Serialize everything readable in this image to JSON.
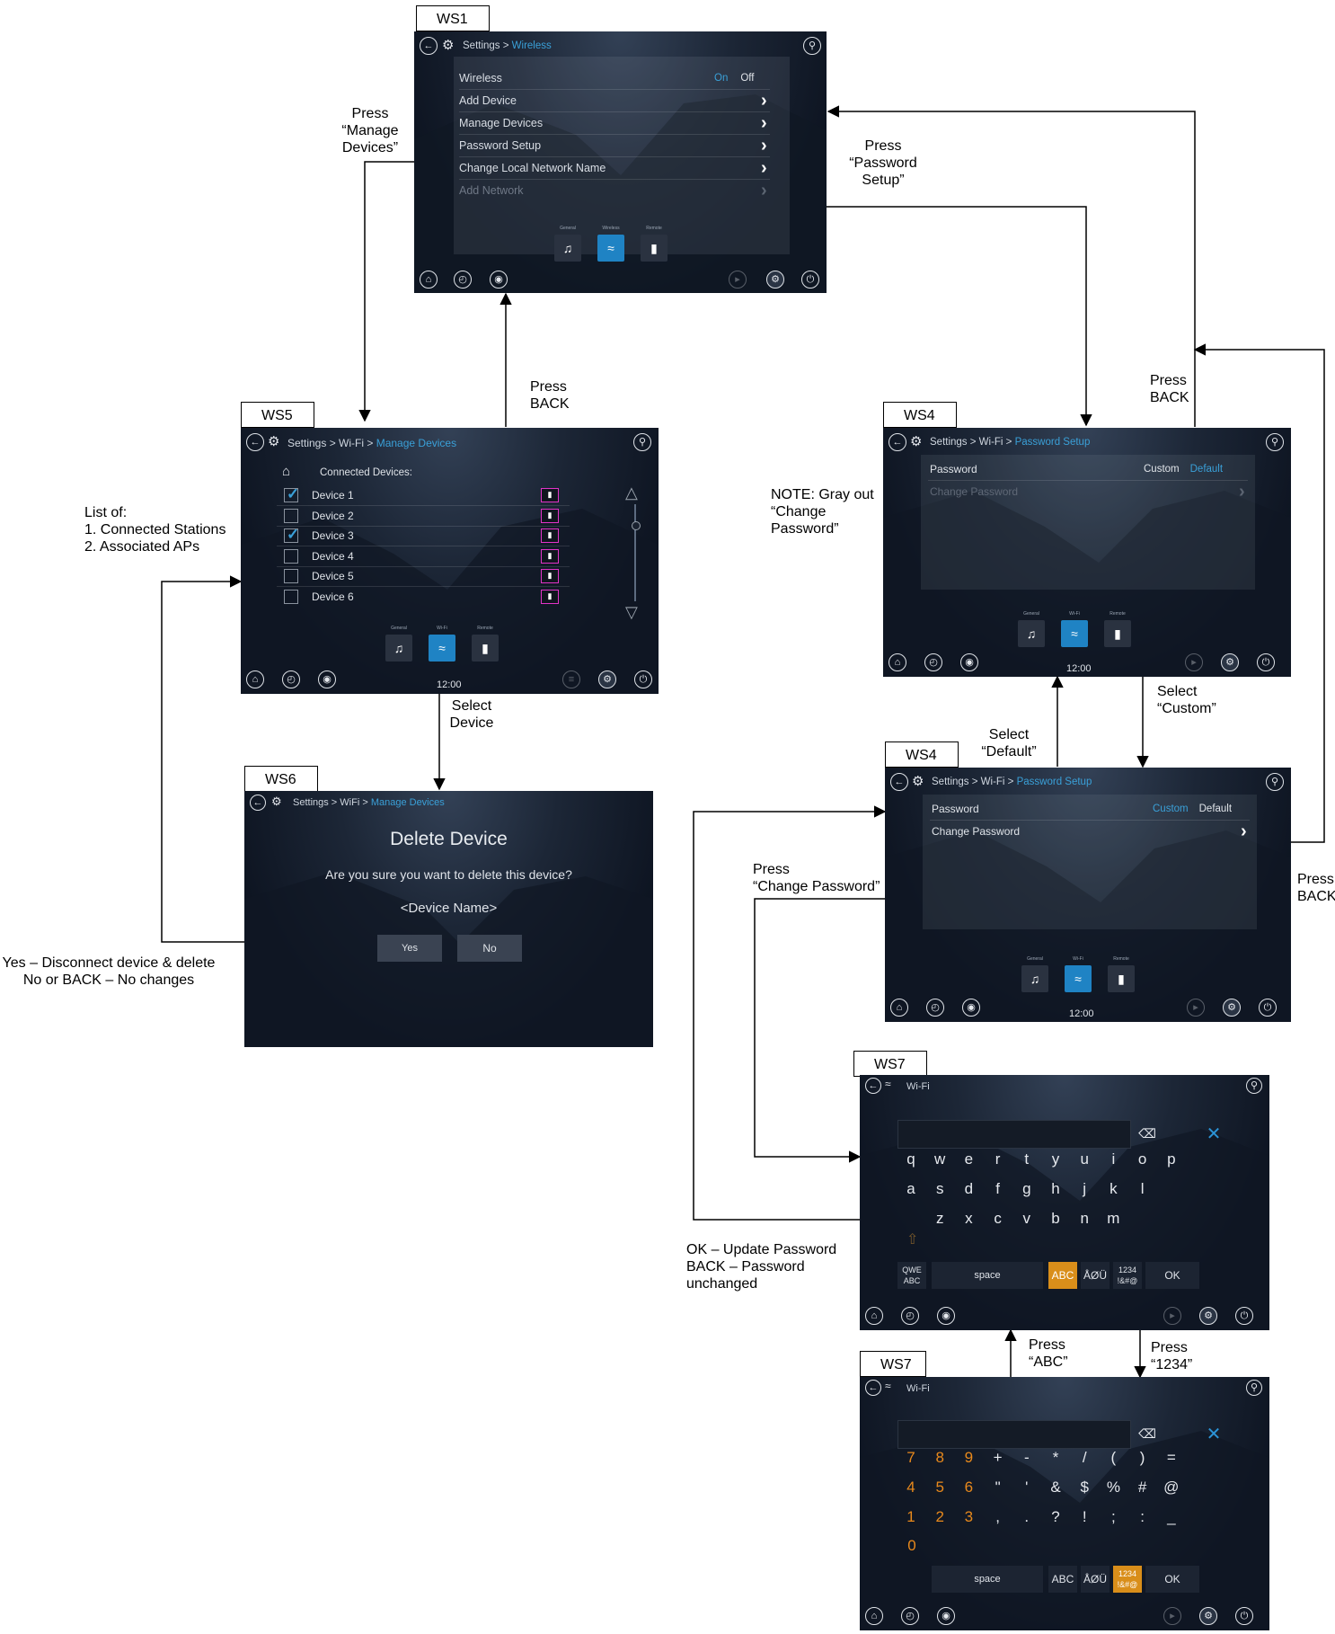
{
  "screens": {
    "ws1": {
      "tag": "WS1",
      "crumb_prefix": "Settings > ",
      "crumb_current": "Wireless",
      "menu": [
        {
          "label": "Wireless"
        },
        {
          "label": "Add Device"
        },
        {
          "label": "Manage Devices"
        },
        {
          "label": "Password Setup"
        },
        {
          "label": "Change Local Network Name"
        },
        {
          "label": "Add Network"
        }
      ],
      "toggle_on": "On",
      "toggle_off": "Off",
      "tabs": [
        "General",
        "Wireless",
        "Remote"
      ]
    },
    "ws5": {
      "tag": "WS5",
      "crumb_prefix": "Settings > Wi-Fi > ",
      "crumb_current": "Manage Devices",
      "header": "Connected Devices:",
      "devices": [
        {
          "name": "Device 1",
          "checked": true
        },
        {
          "name": "Device 2",
          "checked": false
        },
        {
          "name": "Device 3",
          "checked": true
        },
        {
          "name": "Device 4",
          "checked": false
        },
        {
          "name": "Device 5",
          "checked": false
        },
        {
          "name": "Device 6",
          "checked": false
        }
      ],
      "tabs": [
        "General",
        "Wi-Fi",
        "Remote"
      ],
      "clock": "12:00"
    },
    "ws6": {
      "tag": "WS6",
      "crumb_prefix": "Settings > WiFi > ",
      "crumb_current": "Manage Devices",
      "title": "Delete Device",
      "question": "Are you sure you want to delete this device?",
      "device_name": "<Device Name>",
      "yes": "Yes",
      "no": "No"
    },
    "ws4a": {
      "tag": "WS4",
      "crumb_prefix": "Settings > Wi-Fi > ",
      "crumb_current": "Password Setup",
      "password_label": "Password",
      "custom": "Custom",
      "default": "Default",
      "change_password": "Change Password",
      "tabs": [
        "General",
        "Wi-Fi",
        "Remote"
      ],
      "clock": "12:00"
    },
    "ws4b": {
      "tag": "WS4",
      "crumb_prefix": "Settings > Wi-Fi > ",
      "crumb_current": "Password Setup",
      "password_label": "Password",
      "custom": "Custom",
      "default": "Default",
      "change_password": "Change Password",
      "tabs": [
        "General",
        "Wi-Fi",
        "Remote"
      ],
      "clock": "12:00"
    },
    "ws7a": {
      "tag": "WS7",
      "crumb": "Wi-Fi",
      "rows": [
        [
          "q",
          "w",
          "e",
          "r",
          "t",
          "y",
          "u",
          "i",
          "o",
          "p"
        ],
        [
          "a",
          "s",
          "d",
          "f",
          "g",
          "h",
          "j",
          "k",
          "l"
        ],
        [
          "z",
          "x",
          "c",
          "v",
          "b",
          "n",
          "m"
        ]
      ],
      "qwe": "QWE\nABC",
      "space": "space",
      "abc": "ABC",
      "intl": "ÅØÜ",
      "num": "1234\n!&#@",
      "ok": "OK"
    },
    "ws7b": {
      "tag": "WS7",
      "crumb": "Wi-Fi",
      "rows": [
        [
          "7",
          "8",
          "9",
          "+",
          "-",
          "*",
          "/",
          "(",
          ")",
          "="
        ],
        [
          "4",
          "5",
          "6",
          "\"",
          "'",
          "&",
          "$",
          "%",
          "#",
          "@"
        ],
        [
          "1",
          "2",
          "3",
          ",",
          ".",
          "?",
          "!",
          ";",
          ":",
          "_"
        ]
      ],
      "zero": "0",
      "space": "space",
      "abc": "ABC",
      "intl": "ÅØÜ",
      "num": "1234\n!&#@",
      "ok": "OK"
    }
  },
  "annotations": {
    "press_manage": "Press\n“Manage\nDevices”",
    "press_password_setup": "Press\n“Password\nSetup”",
    "press_back_ws5": "Press\nBACK",
    "press_back_ws4": "Press\nBACK",
    "press_back_right": "Press\nBACK",
    "list_of": "List of:\n1. Connected Stations\n2. Associated APs",
    "gray_note": "NOTE: Gray out\n“Change\nPassword”",
    "select_device": "Select\nDevice",
    "select_custom": "Select\n“Custom”",
    "select_default": "Select\n“Default”",
    "yes_no": "Yes – Disconnect device & delete\nNo or BACK – No changes",
    "press_change_password": "Press\n“Change Password”",
    "ok_back": "OK – Update Password\nBACK – Password\n              unchanged",
    "press_abc": "Press\n“ABC”",
    "press_1234": "Press\n“1234”"
  }
}
